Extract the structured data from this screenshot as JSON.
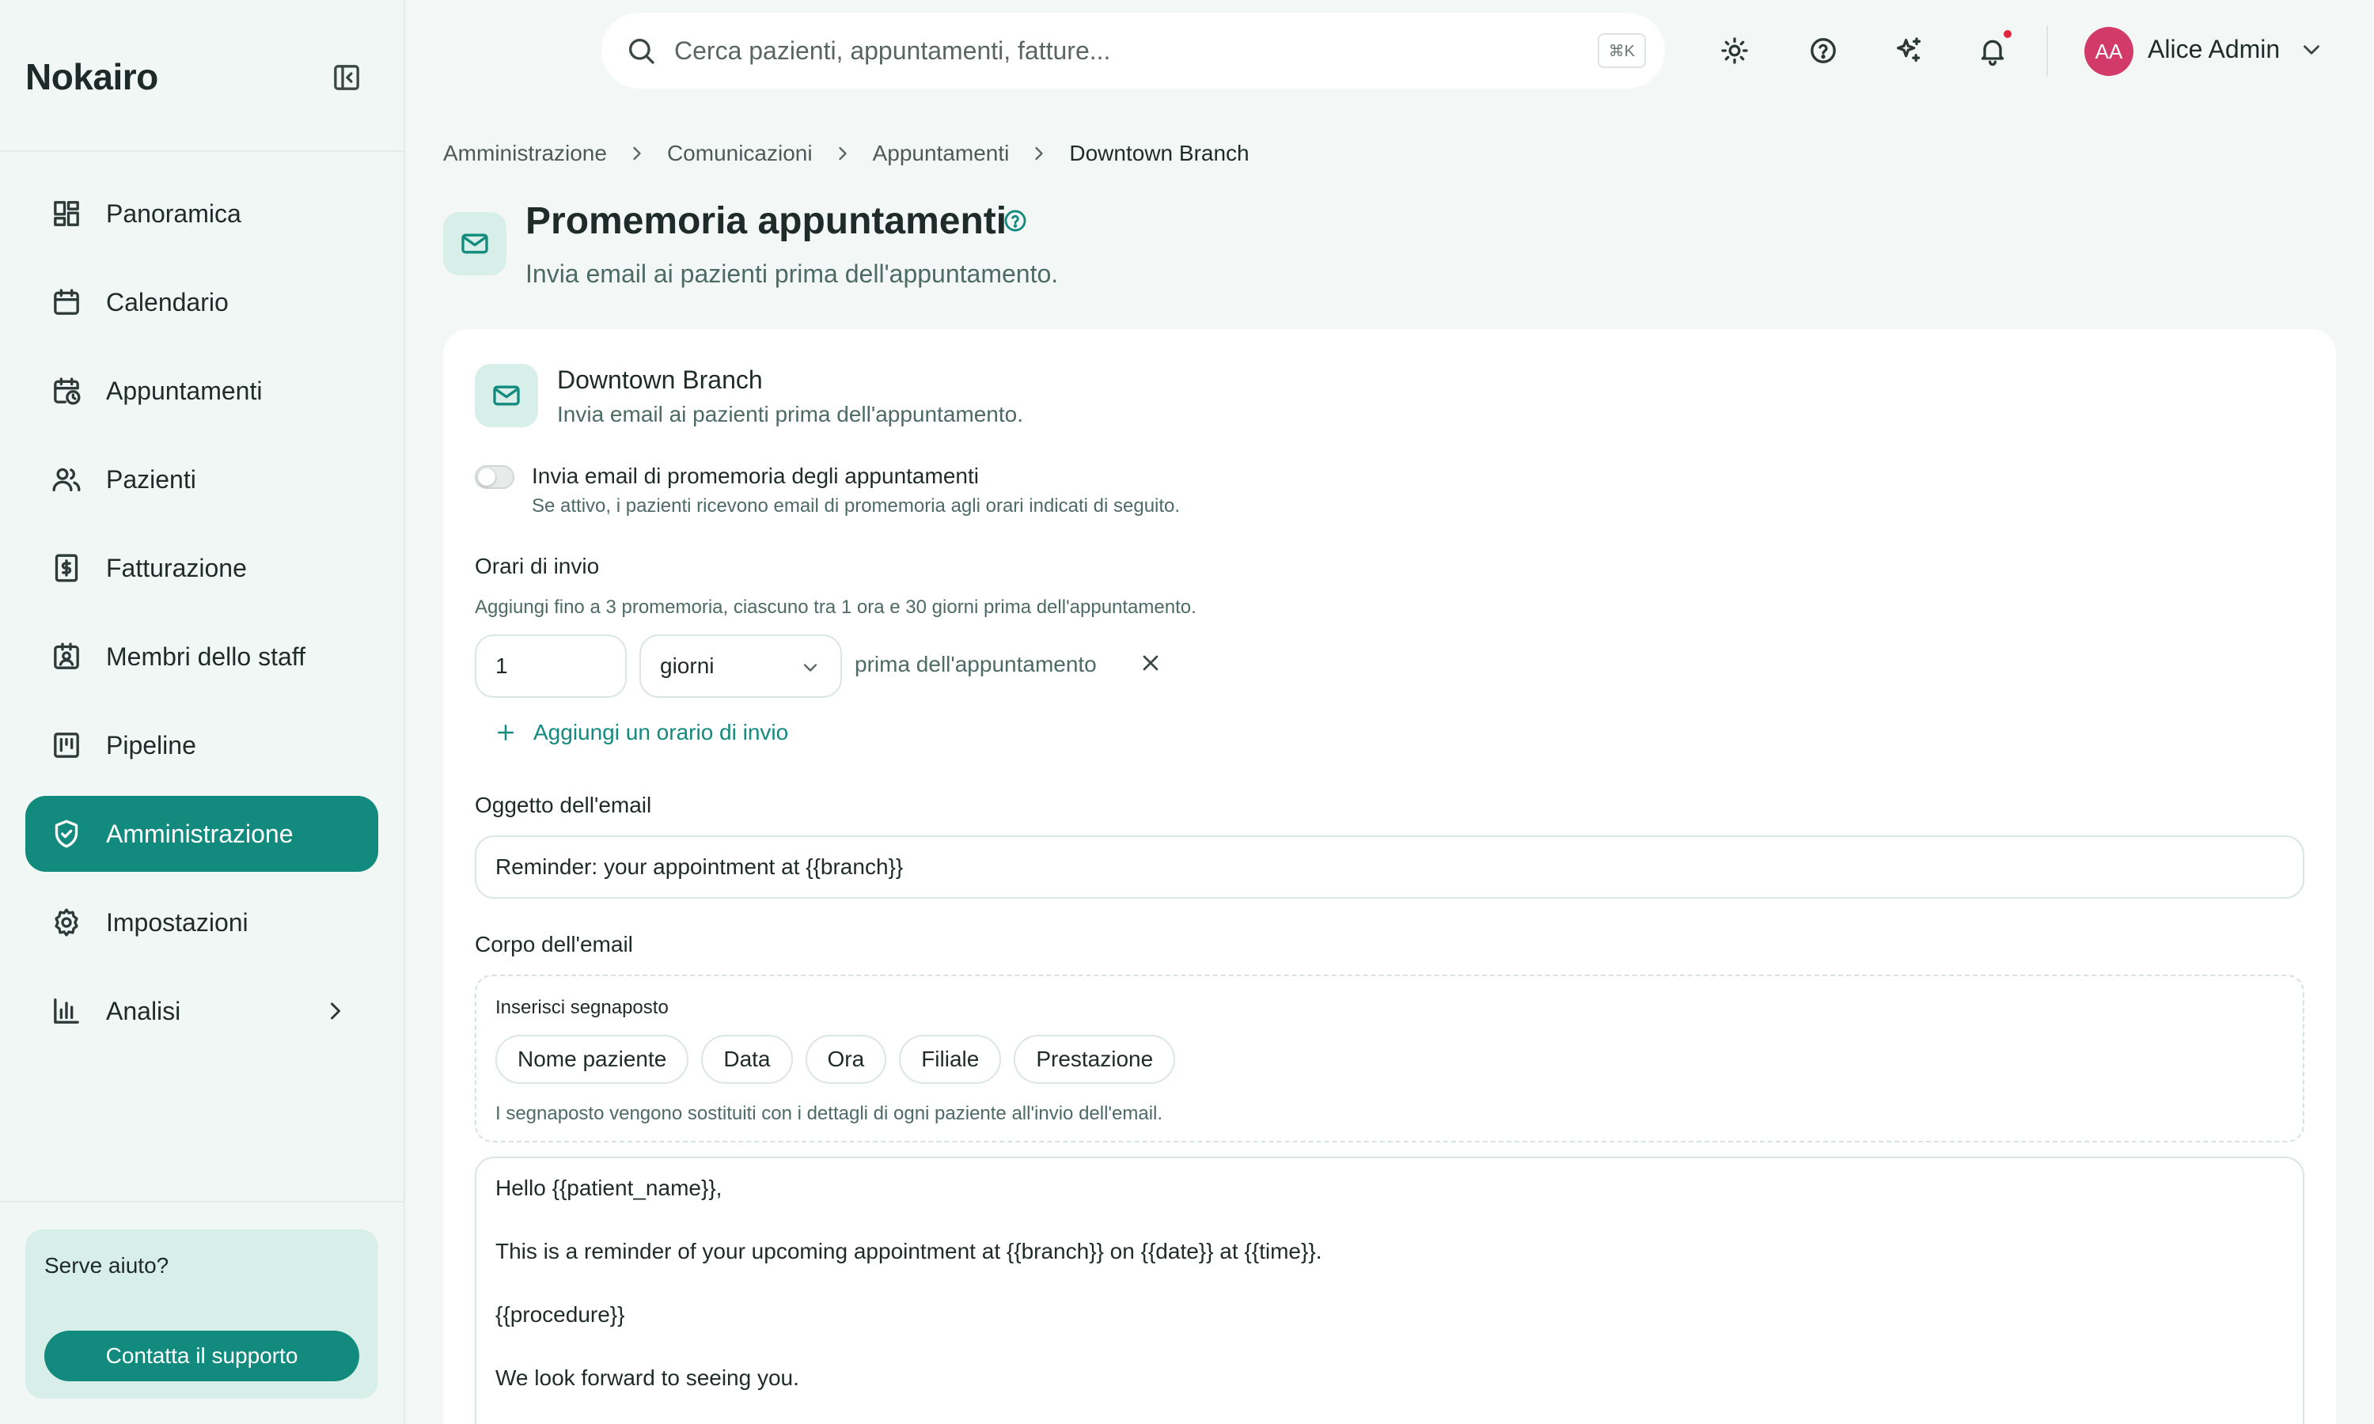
{
  "app": {
    "brand": "Nokairo"
  },
  "sidebar": {
    "items": [
      {
        "label": "Panoramica",
        "icon": "dashboard-icon",
        "active": false
      },
      {
        "label": "Calendario",
        "icon": "calendar-icon",
        "active": false
      },
      {
        "label": "Appuntamenti",
        "icon": "calendar-clock-icon",
        "active": false
      },
      {
        "label": "Pazienti",
        "icon": "users-icon",
        "active": false
      },
      {
        "label": "Fatturazione",
        "icon": "receipt-icon",
        "active": false
      },
      {
        "label": "Membri dello staff",
        "icon": "staff-badge-icon",
        "active": false
      },
      {
        "label": "Pipeline",
        "icon": "kanban-icon",
        "active": false
      },
      {
        "label": "Amministrazione",
        "icon": "shield-check-icon",
        "active": true
      },
      {
        "label": "Impostazioni",
        "icon": "gear-icon",
        "active": false
      },
      {
        "label": "Analisi",
        "icon": "bar-chart-icon",
        "active": false,
        "has_submenu": true
      }
    ],
    "help": {
      "title": "Serve aiuto?",
      "button": "Contatta il supporto"
    }
  },
  "topbar": {
    "search_placeholder": "Cerca pazienti, appuntamenti, fatture...",
    "search_shortcut": "⌘K",
    "user": {
      "initials": "AA",
      "name": "Alice Admin"
    },
    "has_unread_notifications": true
  },
  "breadcrumb": [
    "Amministrazione",
    "Comunicazioni",
    "Appuntamenti",
    "Downtown Branch"
  ],
  "page": {
    "title": "Promemoria appuntamenti",
    "subtitle": "Invia email ai pazienti prima dell'appuntamento."
  },
  "card": {
    "title": "Downtown Branch",
    "subtitle": "Invia email ai pazienti prima dell'appuntamento.",
    "toggle": {
      "enabled": false,
      "label": "Invia email di promemoria degli appuntamenti",
      "help": "Se attivo, i pazienti ricevono email di promemoria agli orari indicati di seguito."
    },
    "schedule": {
      "label": "Orari di invio",
      "help": "Aggiungi fino a 3 promemoria, ciascuno tra 1 ora e 30 giorni prima dell'appuntamento.",
      "rows": [
        {
          "value": "1",
          "unit": "giorni",
          "suffix": "prima dell'appuntamento"
        }
      ],
      "add_label": "Aggiungi un orario di invio"
    },
    "subject": {
      "label": "Oggetto dell'email",
      "value": "Reminder: your appointment at {{branch}}"
    },
    "body": {
      "label": "Corpo dell'email",
      "placeholders_title": "Inserisci segnaposto",
      "placeholders": [
        "Nome paziente",
        "Data",
        "Ora",
        "Filiale",
        "Prestazione"
      ],
      "placeholders_help": "I segnaposto vengono sostituiti con i dettagli di ogni paziente all'invio dell'email.",
      "lines": [
        "Hello {{patient_name}},",
        "",
        "This is a reminder of your upcoming appointment at {{branch}} on {{date}} at {{time}}.",
        "",
        "{{procedure}}",
        "",
        "We look forward to seeing you."
      ]
    }
  },
  "colors": {
    "accent": "#128a7e",
    "accent_soft": "#d8eee8",
    "background": "#f3f8f6",
    "notification": "#e0263c",
    "avatar": "#d23a6a"
  }
}
